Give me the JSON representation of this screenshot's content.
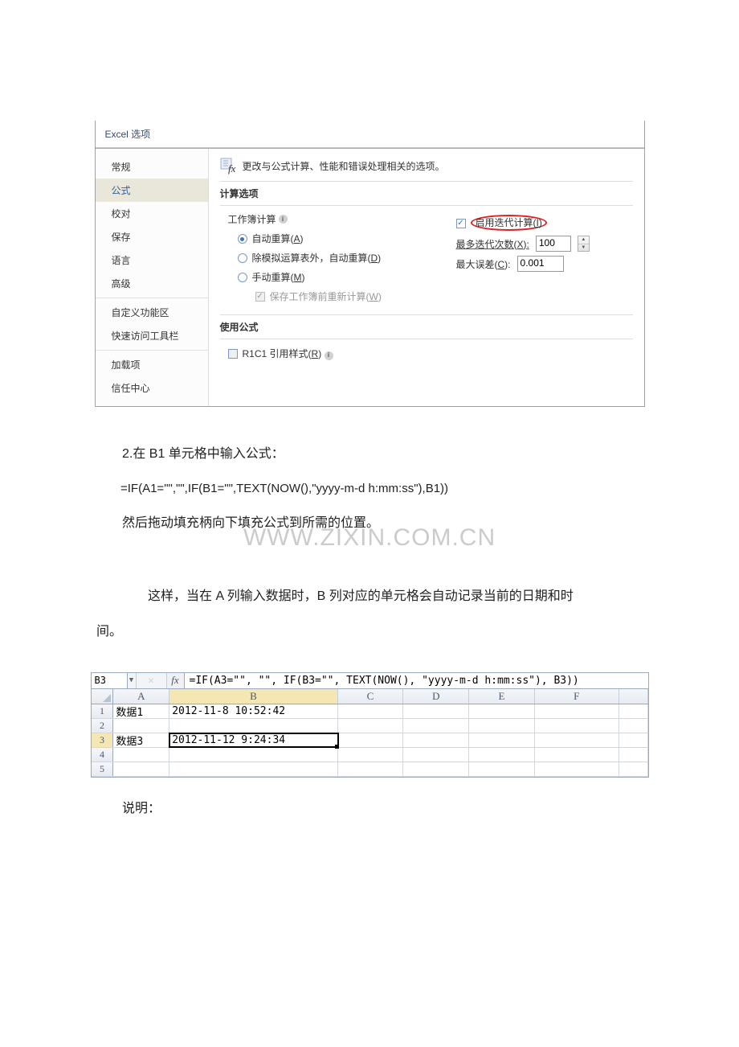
{
  "dialog": {
    "title": "Excel 选项",
    "sidebar": {
      "items": [
        {
          "label": "常规"
        },
        {
          "label": "公式",
          "selected": true
        },
        {
          "label": "校对"
        },
        {
          "label": "保存"
        },
        {
          "label": "语言"
        },
        {
          "label": "高级"
        },
        {
          "label": "自定义功能区"
        },
        {
          "label": "快速访问工具栏"
        },
        {
          "label": "加载项"
        },
        {
          "label": "信任中心"
        }
      ]
    },
    "header_text": "更改与公式计算、性能和错误处理相关的选项。",
    "section_calc": "计算选项",
    "workbook_calc_label": "工作簿计算",
    "radios": {
      "auto": "自动重算(A)",
      "except_tables": "除模拟运算表外，自动重算(D)",
      "manual": "手动重算(M)"
    },
    "recalc_before_save": "保存工作簿前重新计算(W)",
    "enable_iter": "启用迭代计算(I)",
    "max_iter_label": "最多迭代次数(X):",
    "max_iter_value": "100",
    "max_change_label": "最大误差(C):",
    "max_change_value": "0.001",
    "section_formula": "使用公式",
    "r1c1_label": "R1C1 引用样式(R)"
  },
  "body": {
    "p1": "2.在 B1 单元格中输入公式：",
    "formula": "=IF(A1=\"\",\"\",IF(B1=\"\",TEXT(NOW(),\"yyyy-m-d h:mm:ss\"),B1))",
    "p2": "然后拖动填充柄向下填充公式到所需的位置。",
    "watermark": "WWW.ZIXIN.COM.CN",
    "p3": "这样，当在 A 列输入数据时，B 列对应的单元格会自动记录当前的日期和时间。",
    "p4": "说明："
  },
  "sheet": {
    "namebox": "B3",
    "fx_label": "fx",
    "formula": "=IF(A3=\"\", \"\", IF(B3=\"\", TEXT(NOW(), \"yyyy-m-d h:mm:ss\"), B3))",
    "cols": [
      "A",
      "B",
      "C",
      "D",
      "E",
      "F"
    ],
    "rows": [
      {
        "n": "1",
        "A": "数据1",
        "B": "2012-11-8 10:52:42"
      },
      {
        "n": "2",
        "A": "",
        "B": ""
      },
      {
        "n": "3",
        "A": "数据3",
        "B": "2012-11-12 9:24:34",
        "active": true
      },
      {
        "n": "4",
        "A": "",
        "B": ""
      },
      {
        "n": "5",
        "A": "",
        "B": ""
      }
    ]
  }
}
